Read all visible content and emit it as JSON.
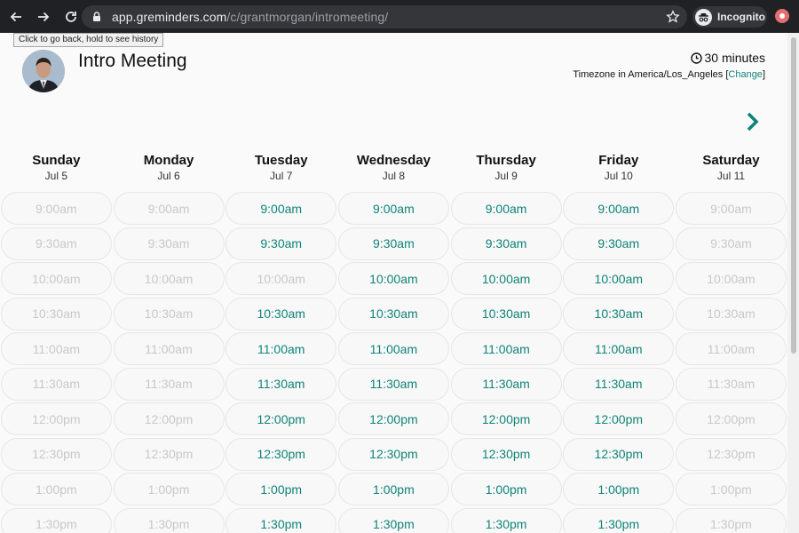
{
  "browser": {
    "url_host": "app.greminders.com",
    "url_path": "/c/grantmorgan/intromeeting/",
    "incognito_label": "Incognito",
    "tooltip": "Click to go back, hold to see history"
  },
  "header": {
    "title": "Intro Meeting",
    "duration": "30 minutes",
    "timezone_prefix": "Timezone in America/Los_Angeles [",
    "timezone_link": "Change",
    "timezone_suffix": "]"
  },
  "colors": {
    "accent": "#0f8478",
    "disabled": "#c8c8c8"
  },
  "days": [
    {
      "name": "Sunday",
      "date": "Jul 5"
    },
    {
      "name": "Monday",
      "date": "Jul 6"
    },
    {
      "name": "Tuesday",
      "date": "Jul 7"
    },
    {
      "name": "Wednesday",
      "date": "Jul 8"
    },
    {
      "name": "Thursday",
      "date": "Jul 9"
    },
    {
      "name": "Friday",
      "date": "Jul 10"
    },
    {
      "name": "Saturday",
      "date": "Jul 11"
    }
  ],
  "times": [
    "9:00am",
    "9:30am",
    "10:00am",
    "10:30am",
    "11:00am",
    "11:30am",
    "12:00pm",
    "12:30pm",
    "1:00pm",
    "1:30pm"
  ],
  "availability": [
    [
      false,
      false,
      true,
      true,
      true,
      true,
      false
    ],
    [
      false,
      false,
      true,
      true,
      true,
      true,
      false
    ],
    [
      false,
      false,
      false,
      true,
      true,
      true,
      false
    ],
    [
      false,
      false,
      true,
      true,
      true,
      true,
      false
    ],
    [
      false,
      false,
      true,
      true,
      true,
      true,
      false
    ],
    [
      false,
      false,
      true,
      true,
      true,
      true,
      false
    ],
    [
      false,
      false,
      true,
      true,
      true,
      true,
      false
    ],
    [
      false,
      false,
      true,
      true,
      true,
      true,
      false
    ],
    [
      false,
      false,
      true,
      true,
      true,
      true,
      false
    ],
    [
      false,
      false,
      true,
      true,
      true,
      true,
      false
    ]
  ]
}
